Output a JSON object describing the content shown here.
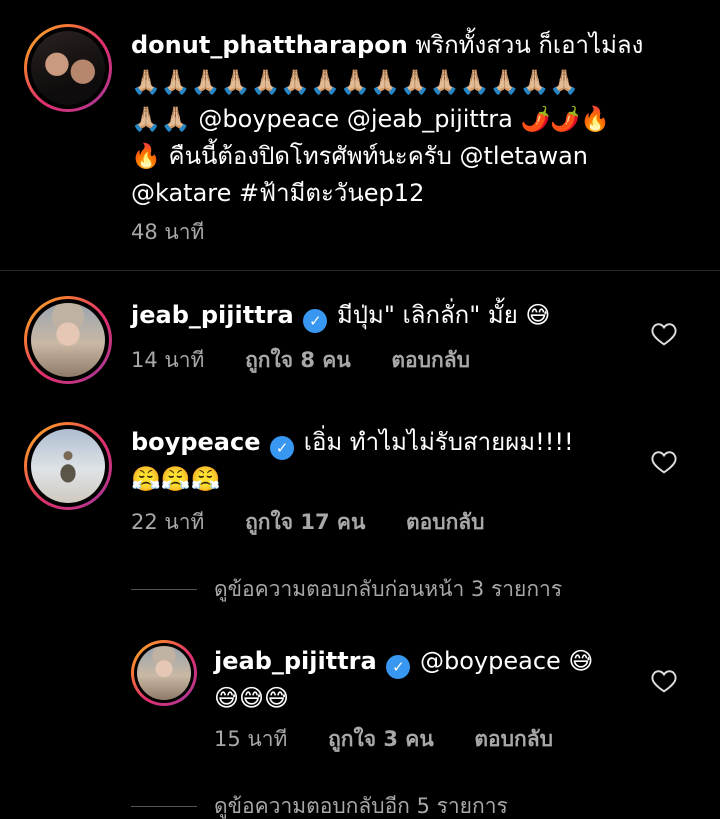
{
  "caption": {
    "username": "donut_phattharapon",
    "line1_rest": "พริกทั้งสวน ก็เอาไม่ลง",
    "line2": "🙏🏼🙏🏼🙏🏼🙏🏼🙏🏼🙏🏼🙏🏼🙏🏼🙏🏼🙏🏼🙏🏼🙏🏼🙏🏼🙏🏼🙏🏼",
    "line3_emoji": "🙏🏼🙏🏼",
    "line3_text": " @boypeace @jeab_pijittra ",
    "line3_end": "🌶️🌶️🔥",
    "line4_emoji": "🔥",
    "line4_text": " คืนนี้ต้องปิดโทรศัพท์นะครับ @tletawan",
    "line5": "@katare #ฟ้ามีตะวันep12",
    "time": "48 นาที"
  },
  "comments": [
    {
      "username": "jeab_pijittra",
      "text": " มีปุ่ม\" เลิกลั่ก\" มั้ย ",
      "emoji": "😅",
      "time": "14 นาที",
      "likes": "ถูกใจ 8 คน",
      "reply": "ตอบกลับ"
    },
    {
      "username": "boypeace",
      "text": " เอิ่ม ทำไมไม่รับสายผม!!!!",
      "emoji_line": "😤😤😤",
      "time": "22 นาที",
      "likes": "ถูกใจ 17 คน",
      "reply": "ตอบกลับ"
    }
  ],
  "view_previous": "ดูข้อความตอบกลับก่อนหน้า 3 รายการ",
  "reply": {
    "username": "jeab_pijittra",
    "text": " @boypeace ",
    "emoji": "😅",
    "emoji_line": "😅😅😅",
    "time": "15 นาที",
    "likes": "ถูกใจ 3 คน",
    "reply": "ตอบกลับ"
  },
  "view_more": "ดูข้อความตอบกลับอีก 5 รายการ",
  "verified_mark": "✓",
  "colors": {
    "background": "#000000",
    "verified": "#3897f0",
    "secondary_text": "#a8a8a8"
  }
}
